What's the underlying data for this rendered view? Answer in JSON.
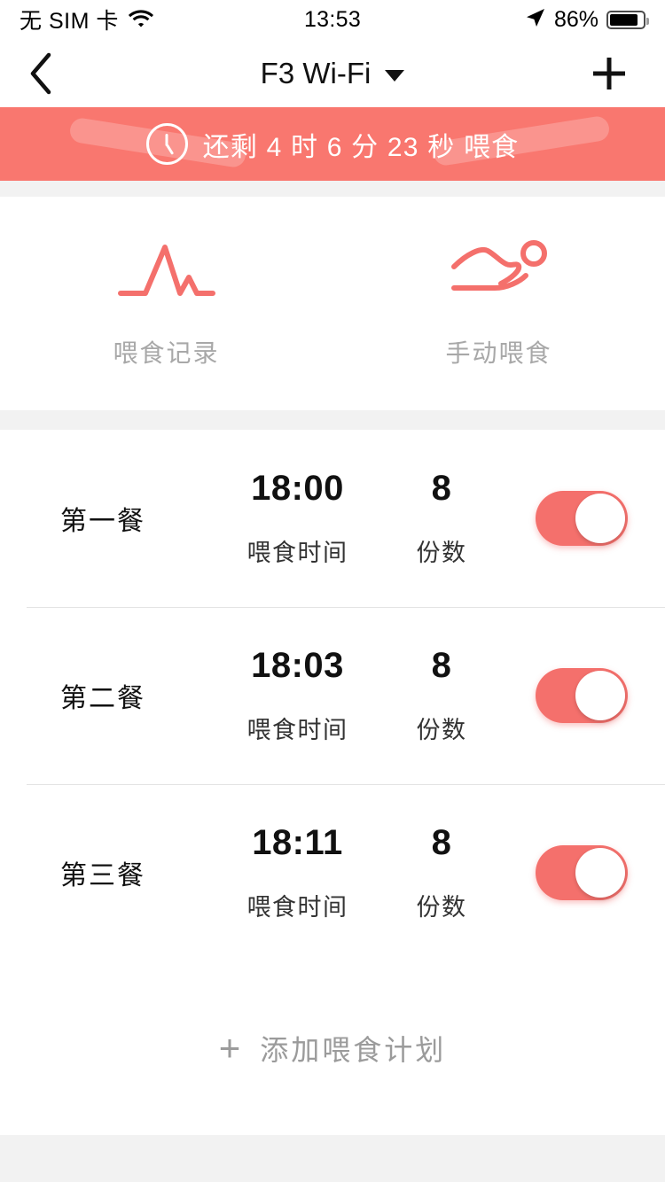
{
  "status_bar": {
    "carrier": "无 SIM 卡",
    "wifi_icon": "wifi-icon",
    "time": "13:53",
    "location_icon": "location-arrow-icon",
    "battery_percent": "86%",
    "battery_icon": "battery-icon"
  },
  "nav_bar": {
    "back_icon": "chevron-left-icon",
    "title": "F3 Wi-Fi",
    "dropdown_icon": "caret-down-icon",
    "add_icon": "plus-icon"
  },
  "banner": {
    "clock_icon": "clock-icon",
    "text": "还剩 4 时 6 分 23 秒 喂食",
    "background_color": "#f9776f",
    "text_color": "#ffffff"
  },
  "shortcuts": [
    {
      "icon": "pulse-line-icon",
      "label": "喂食记录"
    },
    {
      "icon": "hand-feed-icon",
      "label": "手动喂食"
    }
  ],
  "meals": {
    "column_labels": {
      "time": "喂食时间",
      "portion": "份数"
    },
    "rows": [
      {
        "name": "第一餐",
        "time": "18:00",
        "portion": "8",
        "enabled": true
      },
      {
        "name": "第二餐",
        "time": "18:03",
        "portion": "8",
        "enabled": true
      },
      {
        "name": "第三餐",
        "time": "18:11",
        "portion": "8",
        "enabled": true
      }
    ]
  },
  "add_plan": {
    "plus": "+",
    "label": "添加喂食计划"
  },
  "colors": {
    "accent": "#f4706c",
    "banner": "#f9776f",
    "page_bg": "#f2f2f2",
    "muted_text": "#a8a8a8"
  }
}
